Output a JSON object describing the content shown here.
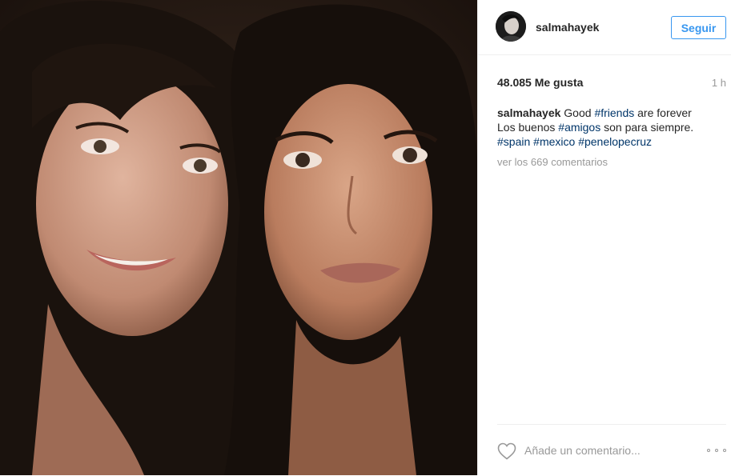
{
  "post": {
    "photo": {
      "icon": "photo-image",
      "colors": {
        "background": "#2a1d16",
        "hair": "#1a120d",
        "skin_left": "#c89880",
        "skin_right": "#c58d70"
      }
    },
    "header": {
      "username": "salmahayek",
      "follow_label": "Seguir",
      "avatar_icon": "avatar-image"
    },
    "meta": {
      "likes": "48.085 Me gusta",
      "time": "1 h"
    },
    "caption": {
      "user": "salmahayek",
      "text_1": "Good",
      "tag_friends": "#friends",
      "text_2": "are forever",
      "text_3": "Los buenos",
      "tag_amigos": "#amigos",
      "text_4": "son para siempre.",
      "tag_spain": "#spain",
      "tag_mexico": "#mexico",
      "tag_penelopecruz": "#penelopecruz"
    },
    "view_comments": "ver los 669 comentarios",
    "footer": {
      "comment_placeholder": "Añade un comentario...",
      "like_icon": "heart-icon",
      "options_icon": "more-options-icon"
    },
    "colors": {
      "accent": "#3897f0",
      "hashtag": "#003569",
      "muted": "#999999",
      "text": "#262626",
      "divider": "#efefef"
    }
  }
}
